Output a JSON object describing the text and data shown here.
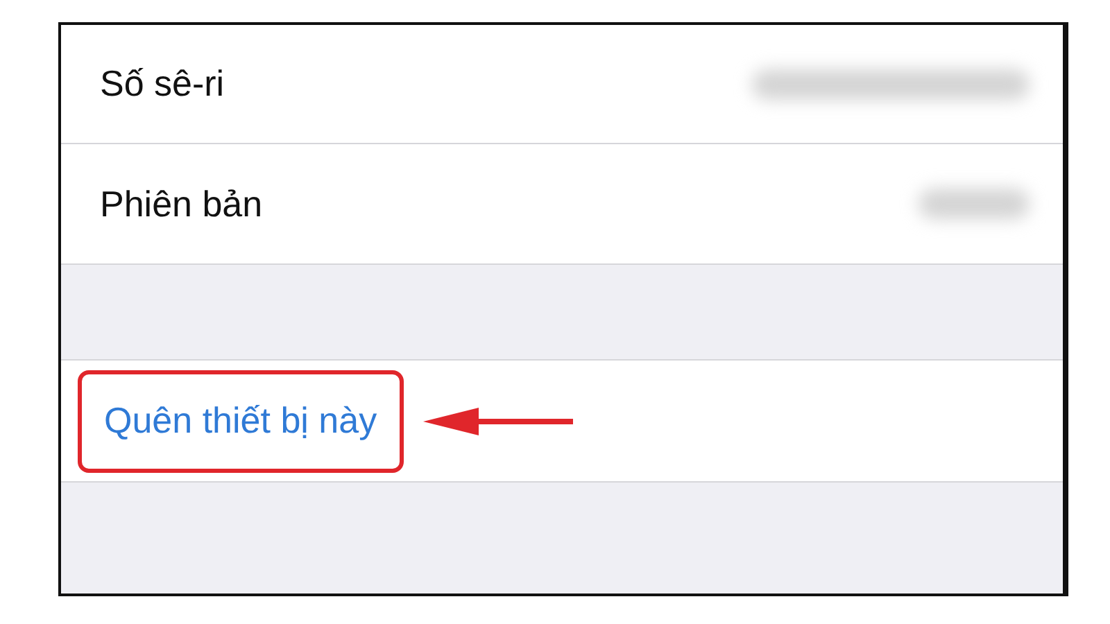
{
  "info_rows": [
    {
      "label": "Số sê-ri",
      "value_hidden": true
    },
    {
      "label": "Phiên bản",
      "value_hidden": true
    }
  ],
  "action": {
    "label": "Quên thiết bị này",
    "highlighted": true
  }
}
